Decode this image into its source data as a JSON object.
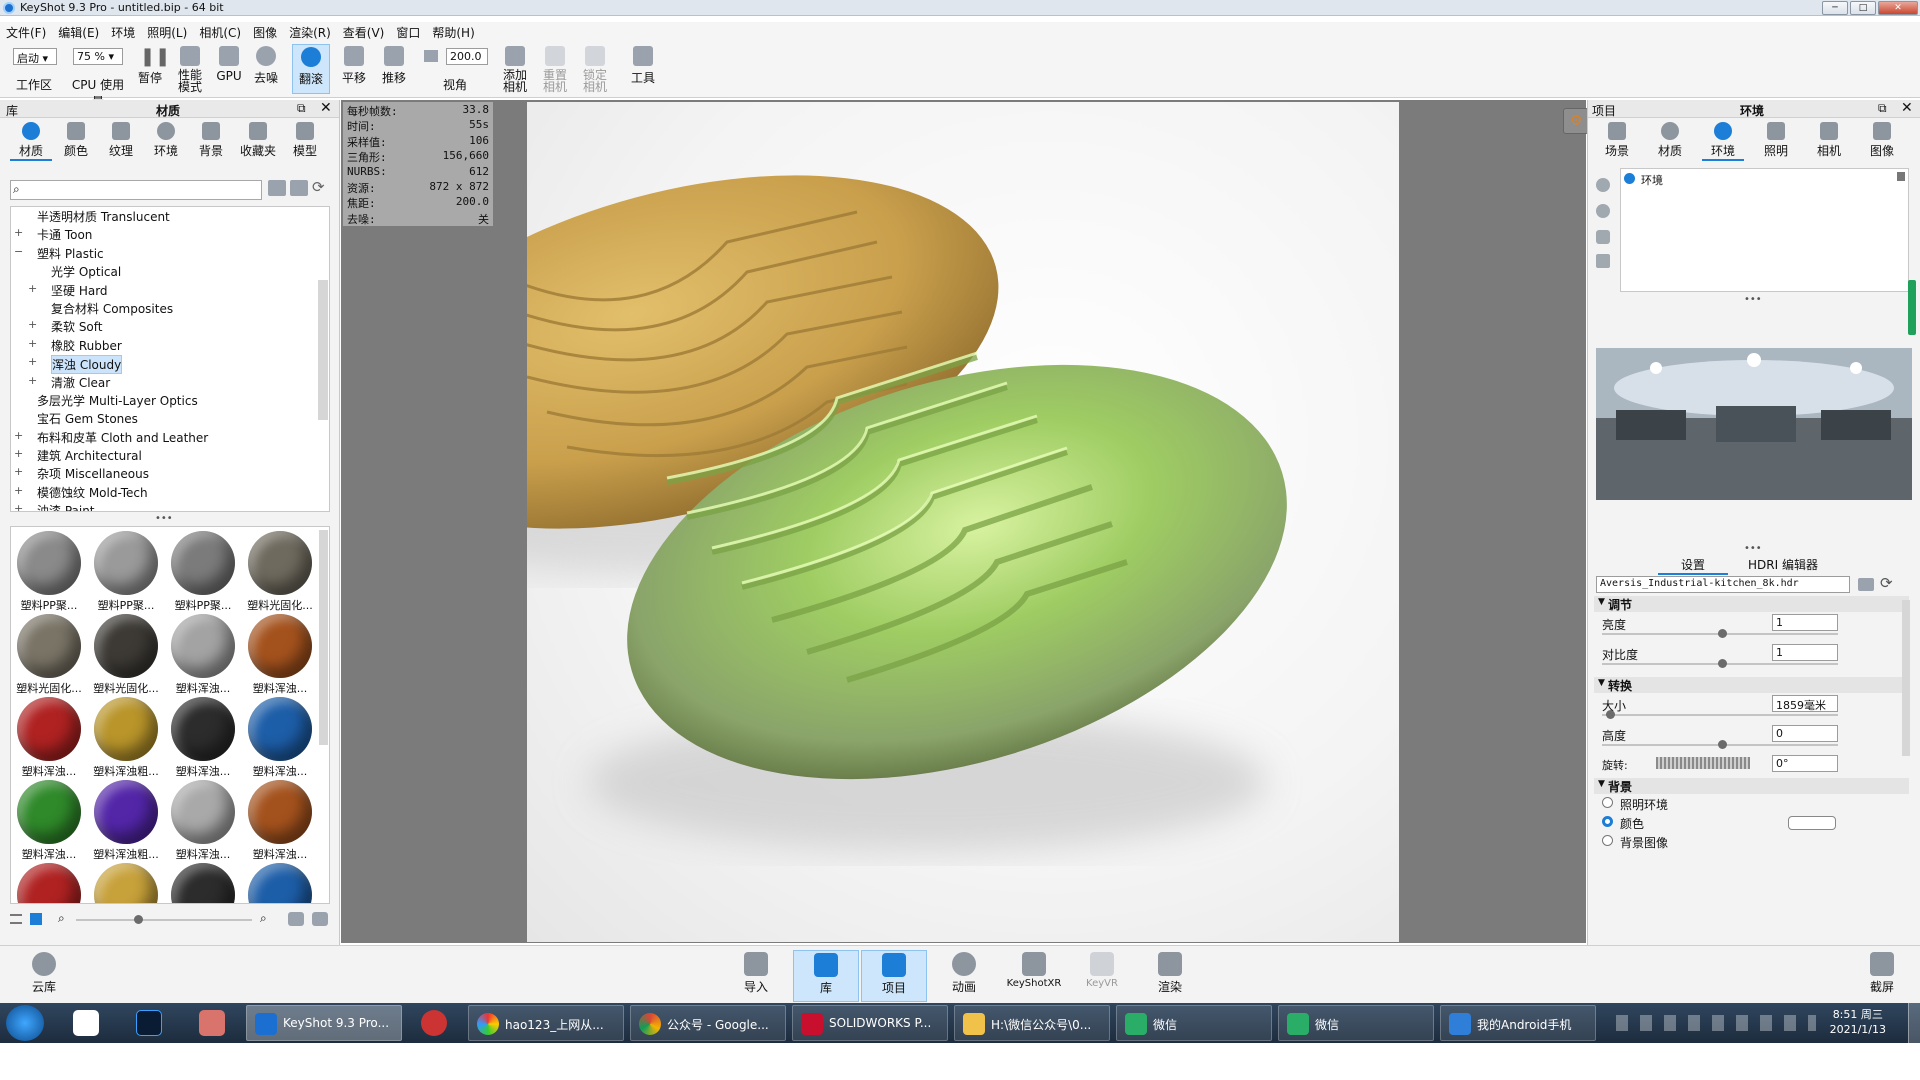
{
  "window": {
    "title": "KeyShot 9.3 Pro  - untitled.bip  - 64 bit"
  },
  "menu": [
    "文件(F)",
    "编辑(E)",
    "环境",
    "照明(L)",
    "相机(C)",
    "图像",
    "渲染(R)",
    "查看(V)",
    "窗口",
    "帮助(H)"
  ],
  "toolbar": {
    "workspace_value": "启动",
    "workspace_label": "工作区",
    "cpu_value": "75 %",
    "cpu_label": "CPU 使用量",
    "pause": "暂停",
    "perf_mode": "性能\n模式",
    "gpu": "GPU",
    "denoise": "去噪",
    "tumble": "翻滚",
    "pan": "平移",
    "dolly": "推移",
    "fov_value": "200.0",
    "fov_label": "视角",
    "add_camera": "添加\n相机",
    "reset_camera": "重置\n相机",
    "lock_camera": "锁定\n相机",
    "tools": "工具"
  },
  "library": {
    "header": "库",
    "title": "材质",
    "tabs": [
      "材质",
      "颜色",
      "纹理",
      "环境",
      "背景",
      "收藏夹",
      "模型"
    ],
    "active_tab": "材质",
    "search_placeholder": "",
    "tree": [
      {
        "label": "半透明材质 Translucent",
        "level": 1,
        "expand": ""
      },
      {
        "label": "卡通 Toon",
        "level": 1,
        "expand": "+"
      },
      {
        "label": "塑料 Plastic",
        "level": 1,
        "expand": "−"
      },
      {
        "label": "光学 Optical",
        "level": 2,
        "expand": ""
      },
      {
        "label": "坚硬 Hard",
        "level": 2,
        "expand": "+"
      },
      {
        "label": "复合材料 Composites",
        "level": 2,
        "expand": ""
      },
      {
        "label": "柔软 Soft",
        "level": 2,
        "expand": "+"
      },
      {
        "label": "橡胶 Rubber",
        "level": 2,
        "expand": "+"
      },
      {
        "label": "浑浊 Cloudy",
        "level": 2,
        "expand": "+",
        "selected": true
      },
      {
        "label": "清澈 Clear",
        "level": 2,
        "expand": "+"
      },
      {
        "label": "多层光学 Multi-Layer Optics",
        "level": 1,
        "expand": ""
      },
      {
        "label": "宝石 Gem Stones",
        "level": 1,
        "expand": ""
      },
      {
        "label": "布料和皮革 Cloth and Leather",
        "level": 1,
        "expand": "+"
      },
      {
        "label": "建筑 Architectural",
        "level": 1,
        "expand": "+"
      },
      {
        "label": "杂项 Miscellaneous",
        "level": 1,
        "expand": "+"
      },
      {
        "label": "模德蚀纹 Mold-Tech",
        "level": 1,
        "expand": "+"
      },
      {
        "label": "油漆 Paint",
        "level": 1,
        "expand": "+"
      }
    ],
    "thumbnails": [
      {
        "label": "塑料PP聚...",
        "color": "#8a8a8a"
      },
      {
        "label": "塑料PP聚...",
        "color": "#9a9a9a"
      },
      {
        "label": "塑料PP聚...",
        "color": "#7b7b7b"
      },
      {
        "label": "塑料光固化...",
        "color": "#6f6a5e"
      },
      {
        "label": "塑料光固化...",
        "color": "#7a7466"
      },
      {
        "label": "塑料光固化...",
        "color": "#3d3a35"
      },
      {
        "label": "塑料浑浊...",
        "color": "#a3a3a3"
      },
      {
        "label": "塑料浑浊...",
        "color": "#a4521d"
      },
      {
        "label": "塑料浑浊...",
        "color": "#b02222"
      },
      {
        "label": "塑料浑浊粗...",
        "color": "#b9952a"
      },
      {
        "label": "塑料浑浊...",
        "color": "#2c2c2c"
      },
      {
        "label": "塑料浑浊...",
        "color": "#1d5ea8"
      },
      {
        "label": "塑料浑浊...",
        "color": "#2f8a2a"
      },
      {
        "label": "塑料浑浊粗...",
        "color": "#5326a8"
      },
      {
        "label": "塑料浑浊...",
        "color": "#a9a9a9"
      },
      {
        "label": "塑料浑浊...",
        "color": "#a4521d"
      },
      {
        "label": "",
        "color": "#b02222"
      },
      {
        "label": "",
        "color": "#c7a13a"
      },
      {
        "label": "",
        "color": "#2c2c2c"
      },
      {
        "label": "",
        "color": "#1d5ea8"
      }
    ]
  },
  "stats": [
    {
      "k": "每秒帧数:",
      "v": "33.8"
    },
    {
      "k": "时间:",
      "v": "55s"
    },
    {
      "k": "采样值:",
      "v": "106"
    },
    {
      "k": "三角形:",
      "v": "156,660"
    },
    {
      "k": "NURBS:",
      "v": "612"
    },
    {
      "k": "资源:",
      "v": "872 x 872"
    },
    {
      "k": "焦距:",
      "v": "200.0"
    },
    {
      "k": "去噪:",
      "v": "关"
    }
  ],
  "project": {
    "header": "项目",
    "title": "环境",
    "tabs": [
      "场景",
      "材质",
      "环境",
      "照明",
      "相机",
      "图像"
    ],
    "active_tab": "环境",
    "env_item": "环境",
    "subtabs": [
      "设置",
      "HDRI 编辑器"
    ],
    "hdri_file": "Aversis_Industrial-kitchen_8k.hdr",
    "adjust_title": "调节",
    "brightness_label": "亮度",
    "brightness_value": "1",
    "contrast_label": "对比度",
    "contrast_value": "1",
    "transform_title": "转换",
    "size_label": "大小",
    "size_value": "1859毫米",
    "height_label": "高度",
    "height_value": "0",
    "rotation_label": "旋转:",
    "rotation_value": "0°",
    "background_title": "背景",
    "bg_options": [
      "照明环境",
      "颜色",
      "背景图像"
    ],
    "bg_selected": "颜色",
    "bg_color": "#ffffff"
  },
  "bottom": {
    "cloud": "云库",
    "import": "导入",
    "library": "库",
    "project": "项目",
    "animation": "动画",
    "keyshotxr": "KeyShotXR",
    "keyvr": "KeyVR",
    "render": "渲染",
    "screenshot": "截屏"
  },
  "taskbar": {
    "items": [
      "KeyShot 9.3 Pro...",
      "hao123_上网从...",
      "公众号 - Google...",
      "SOLIDWORKS P...",
      "H:\\微信公众号\\0...",
      "微信",
      "微信",
      "我的Android手机"
    ],
    "time": "8:51 周三",
    "date": "2021/1/13"
  }
}
